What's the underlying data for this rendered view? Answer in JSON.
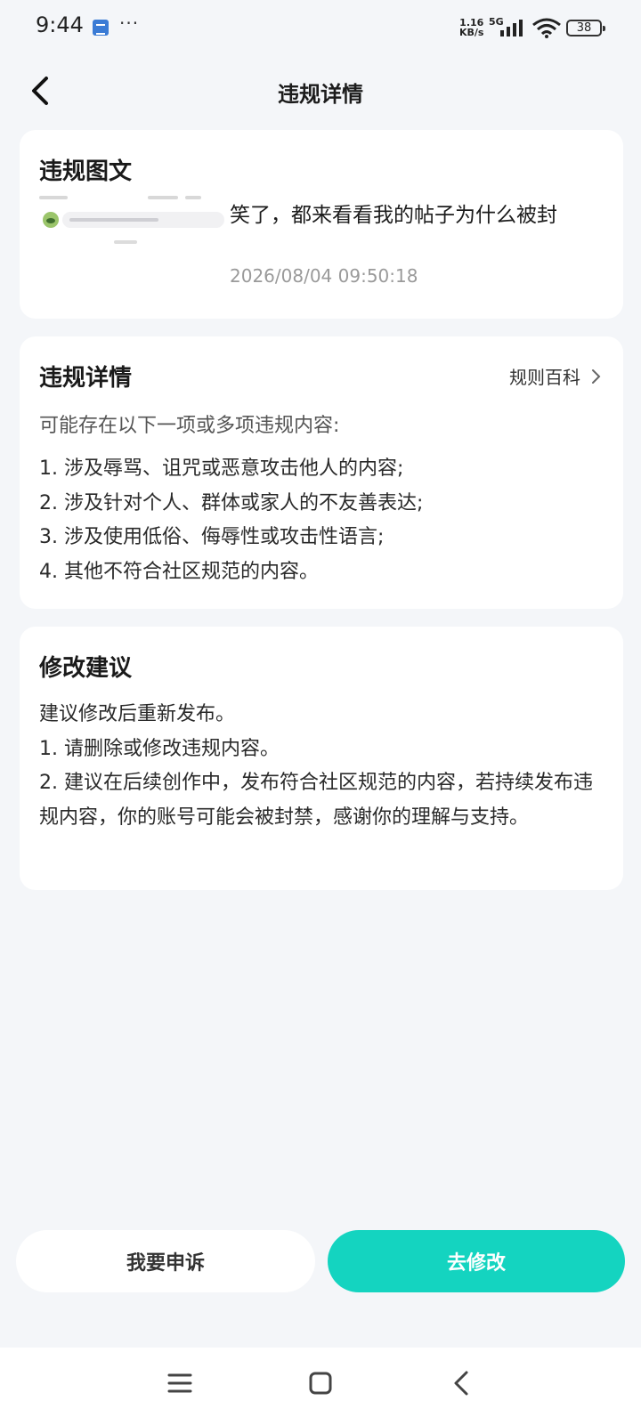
{
  "status_bar": {
    "time": "9:44",
    "more": "···",
    "speed_value": "1.16",
    "speed_unit": "KB/s",
    "network": "5G",
    "battery": "38"
  },
  "header": {
    "title": "违规详情"
  },
  "post_card": {
    "title": "违规图文",
    "post_text": "笑了，都来看看我的帖子为什么被封",
    "timestamp": "2026/08/04 09:50:18"
  },
  "violation_card": {
    "title": "违规详情",
    "rules_link": "规则百科",
    "intro": "可能存在以下一项或多项违规内容:",
    "items": [
      "1. 涉及辱骂、诅咒或恶意攻击他人的内容;",
      "2. 涉及针对个人、群体或家人的不友善表达;",
      "3. 涉及使用低俗、侮辱性或攻击性语言;",
      "4. 其他不符合社区规范的内容。"
    ]
  },
  "advice_card": {
    "title": "修改建议",
    "lines": [
      "建议修改后重新发布。",
      "1. 请删除或修改违规内容。",
      "2. 建议在后续创作中，发布符合社区规范的内容，若持续发布违规内容，你的账号可能会被封禁，感谢你的理解与支持。"
    ]
  },
  "actions": {
    "appeal_label": "我要申诉",
    "modify_label": "去修改"
  },
  "colors": {
    "accent": "#14d4c0",
    "background": "#f4f6f9",
    "card": "#ffffff"
  },
  "icons": {
    "back": "chevron-left-icon",
    "rules_arrow": "chevron-right-icon",
    "sys_menu": "menu-icon",
    "sys_home": "home-square-icon",
    "sys_back": "back-triangle-icon"
  }
}
